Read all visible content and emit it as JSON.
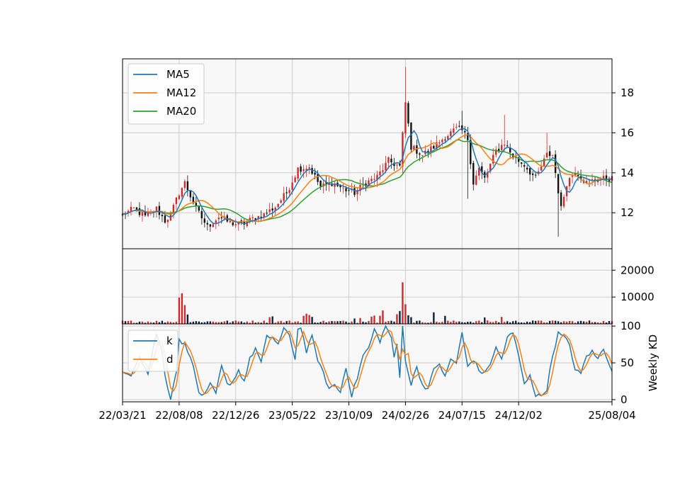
{
  "chart_data": {
    "type": "candlestick",
    "colors": {
      "up": "#d62728",
      "down": "#111111",
      "ma5": "#1f77b4",
      "ma12": "#ff7f0e",
      "ma20": "#2ca02c",
      "k": "#1f77b4",
      "d": "#ff7f0e",
      "panel_bg": "#f8f8f8",
      "grid": "#cccccc"
    },
    "x_tick_labels": [
      "22/03/21",
      "22/08/08",
      "22/12/26",
      "23/05/22",
      "23/10/09",
      "24/02/26",
      "24/07/15",
      "24/12/02",
      "25/08/04"
    ],
    "x_tick_index": [
      0,
      20,
      40,
      60,
      80,
      100,
      120,
      140,
      173
    ],
    "n_weeks": 174,
    "price": {
      "ylim": [
        10.2,
        19.7
      ],
      "yticks": [
        12,
        14,
        16,
        18
      ],
      "anchors": [
        [
          0,
          11.9
        ],
        [
          4,
          12.2
        ],
        [
          8,
          11.8
        ],
        [
          12,
          12.2
        ],
        [
          15,
          11.6
        ],
        [
          17,
          11.9
        ],
        [
          20,
          13.0
        ],
        [
          22,
          13.5
        ],
        [
          26,
          12.2
        ],
        [
          30,
          11.3
        ],
        [
          34,
          11.8
        ],
        [
          38,
          11.5
        ],
        [
          42,
          11.4
        ],
        [
          46,
          11.7
        ],
        [
          50,
          11.9
        ],
        [
          54,
          12.3
        ],
        [
          58,
          13.0
        ],
        [
          62,
          14.2
        ],
        [
          66,
          14.3
        ],
        [
          70,
          13.3
        ],
        [
          74,
          13.5
        ],
        [
          78,
          13.2
        ],
        [
          82,
          13.0
        ],
        [
          86,
          13.5
        ],
        [
          90,
          13.8
        ],
        [
          94,
          14.6
        ],
        [
          98,
          14.3
        ],
        [
          100,
          17.5
        ],
        [
          102,
          15.3
        ],
        [
          106,
          14.9
        ],
        [
          110,
          15.3
        ],
        [
          114,
          15.8
        ],
        [
          118,
          16.2
        ],
        [
          120,
          16.1
        ],
        [
          122,
          15.7
        ],
        [
          124,
          13.5
        ],
        [
          126,
          14.2
        ],
        [
          128,
          13.7
        ],
        [
          132,
          15.1
        ],
        [
          135,
          15.5
        ],
        [
          138,
          14.8
        ],
        [
          142,
          14.4
        ],
        [
          146,
          13.7
        ],
        [
          150,
          14.9
        ],
        [
          152,
          14.9
        ],
        [
          155,
          12.2
        ],
        [
          157,
          13.5
        ],
        [
          160,
          14.1
        ],
        [
          164,
          13.5
        ],
        [
          168,
          13.7
        ],
        [
          173,
          13.7
        ]
      ],
      "spike_weeks": [
        [
          100,
          19.3
        ],
        [
          120,
          17.1
        ],
        [
          135,
          16.9
        ],
        [
          154,
          10.8
        ],
        [
          122,
          12.7
        ],
        [
          150,
          16.0
        ]
      ]
    },
    "volume": {
      "ylim": [
        0,
        28000
      ],
      "yticks": [
        10000,
        20000
      ],
      "yticks_labels": [
        "10000",
        "20000"
      ],
      "spikes": [
        [
          20,
          9800
        ],
        [
          21,
          11400
        ],
        [
          22,
          7000
        ],
        [
          23,
          3500
        ],
        [
          52,
          2500
        ],
        [
          53,
          2800
        ],
        [
          64,
          3000
        ],
        [
          65,
          3800
        ],
        [
          66,
          3300
        ],
        [
          67,
          2600
        ],
        [
          82,
          2000
        ],
        [
          84,
          2200
        ],
        [
          88,
          2700
        ],
        [
          89,
          3100
        ],
        [
          91,
          3000
        ],
        [
          92,
          5000
        ],
        [
          97,
          3600
        ],
        [
          98,
          4800
        ],
        [
          99,
          15500
        ],
        [
          100,
          7300
        ],
        [
          101,
          3200
        ],
        [
          102,
          2500
        ],
        [
          110,
          4300
        ],
        [
          114,
          3000
        ],
        [
          128,
          2400
        ],
        [
          134,
          2600
        ],
        [
          148,
          1200
        ]
      ]
    },
    "kd": {
      "ylabel": "Weekly KD",
      "ylim": [
        -3,
        103
      ],
      "yticks": [
        0,
        50,
        100
      ],
      "k_anchors": [
        [
          0,
          35
        ],
        [
          3,
          35
        ],
        [
          6,
          60
        ],
        [
          9,
          35
        ],
        [
          12,
          90
        ],
        [
          14,
          65
        ],
        [
          15,
          35
        ],
        [
          17,
          0
        ],
        [
          19,
          40
        ],
        [
          20,
          80
        ],
        [
          22,
          75
        ],
        [
          24,
          60
        ],
        [
          27,
          10
        ],
        [
          29,
          5
        ],
        [
          31,
          20
        ],
        [
          33,
          8
        ],
        [
          35,
          45
        ],
        [
          37,
          20
        ],
        [
          39,
          25
        ],
        [
          41,
          40
        ],
        [
          43,
          25
        ],
        [
          45,
          55
        ],
        [
          47,
          70
        ],
        [
          49,
          50
        ],
        [
          51,
          85
        ],
        [
          53,
          85
        ],
        [
          55,
          75
        ],
        [
          57,
          95
        ],
        [
          59,
          88
        ],
        [
          61,
          55
        ],
        [
          62,
          95
        ],
        [
          63,
          100
        ],
        [
          65,
          65
        ],
        [
          67,
          85
        ],
        [
          69,
          55
        ],
        [
          71,
          35
        ],
        [
          73,
          15
        ],
        [
          75,
          20
        ],
        [
          77,
          10
        ],
        [
          79,
          45
        ],
        [
          81,
          5
        ],
        [
          83,
          30
        ],
        [
          85,
          60
        ],
        [
          87,
          70
        ],
        [
          89,
          95
        ],
        [
          91,
          80
        ],
        [
          93,
          100
        ],
        [
          95,
          85
        ],
        [
          96,
          55
        ],
        [
          97,
          75
        ],
        [
          98,
          30
        ],
        [
          99,
          100
        ],
        [
          100,
          55
        ],
        [
          102,
          20
        ],
        [
          104,
          45
        ],
        [
          106,
          20
        ],
        [
          108,
          15
        ],
        [
          110,
          40
        ],
        [
          112,
          50
        ],
        [
          114,
          30
        ],
        [
          116,
          55
        ],
        [
          118,
          50
        ],
        [
          120,
          90
        ],
        [
          122,
          45
        ],
        [
          124,
          55
        ],
        [
          126,
          40
        ],
        [
          128,
          35
        ],
        [
          130,
          50
        ],
        [
          132,
          70
        ],
        [
          134,
          55
        ],
        [
          136,
          85
        ],
        [
          138,
          90
        ],
        [
          140,
          60
        ],
        [
          142,
          20
        ],
        [
          144,
          35
        ],
        [
          146,
          5
        ],
        [
          148,
          5
        ],
        [
          150,
          15
        ],
        [
          152,
          60
        ],
        [
          154,
          90
        ],
        [
          156,
          85
        ],
        [
          158,
          75
        ],
        [
          160,
          40
        ],
        [
          162,
          35
        ],
        [
          164,
          60
        ],
        [
          166,
          65
        ],
        [
          168,
          55
        ],
        [
          170,
          70
        ],
        [
          173,
          40
        ]
      ]
    },
    "legend_price": [
      "MA5",
      "MA12",
      "MA20"
    ],
    "legend_kd": [
      "k",
      "d"
    ]
  }
}
